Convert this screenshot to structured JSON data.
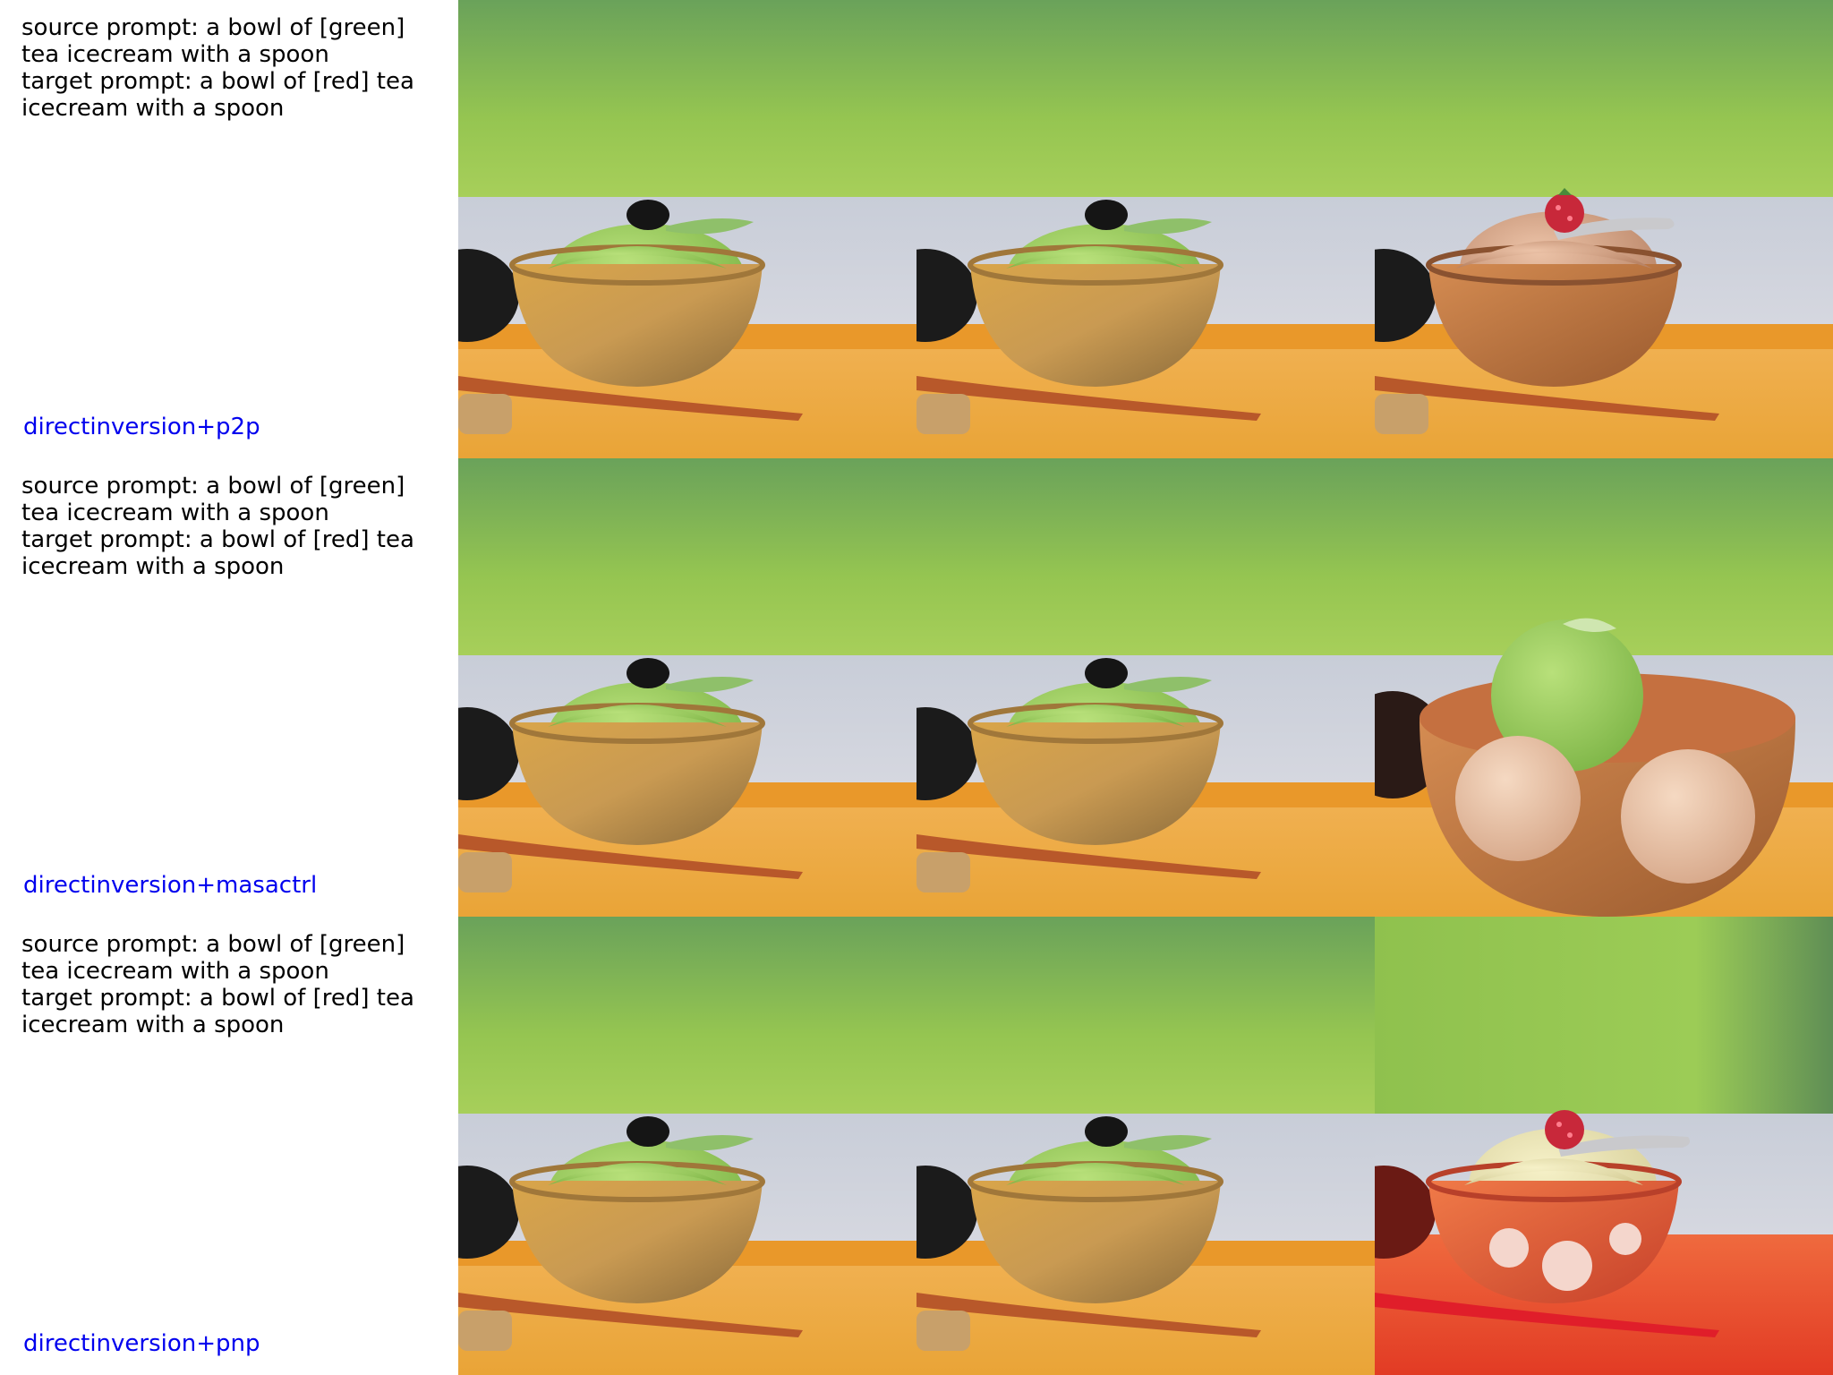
{
  "rows": [
    {
      "source_prompt": "source prompt: a bowl of [green] tea icecream with a spoon",
      "target_prompt": "target prompt: a bowl of [red] tea icecream with a spoon",
      "method": "directinversion+p2p",
      "panels": [
        "green-icecream-bowl",
        "green-icecream-bowl",
        "brown-icecream-raspberry-spoon"
      ]
    },
    {
      "source_prompt": "source prompt: a bowl of [green] tea icecream with a spoon",
      "target_prompt": "target prompt: a bowl of [red] tea icecream with a spoon",
      "method": "directinversion+masactrl",
      "panels": [
        "green-icecream-bowl",
        "green-icecream-bowl",
        "three-scoop-icecream-bowl"
      ]
    },
    {
      "source_prompt": "source prompt: a bowl of [green] tea icecream with a spoon",
      "target_prompt": "target prompt: a bowl of [red] tea icecream with a spoon",
      "method": "directinversion+pnp",
      "panels": [
        "green-icecream-bowl",
        "green-icecream-bowl",
        "cream-icecream-red-bowl"
      ]
    }
  ],
  "colors": {
    "method_label": "#0000ee",
    "matcha": "#9ccf5c",
    "raspberry": "#c8283a",
    "red_table": "#e8442a"
  }
}
